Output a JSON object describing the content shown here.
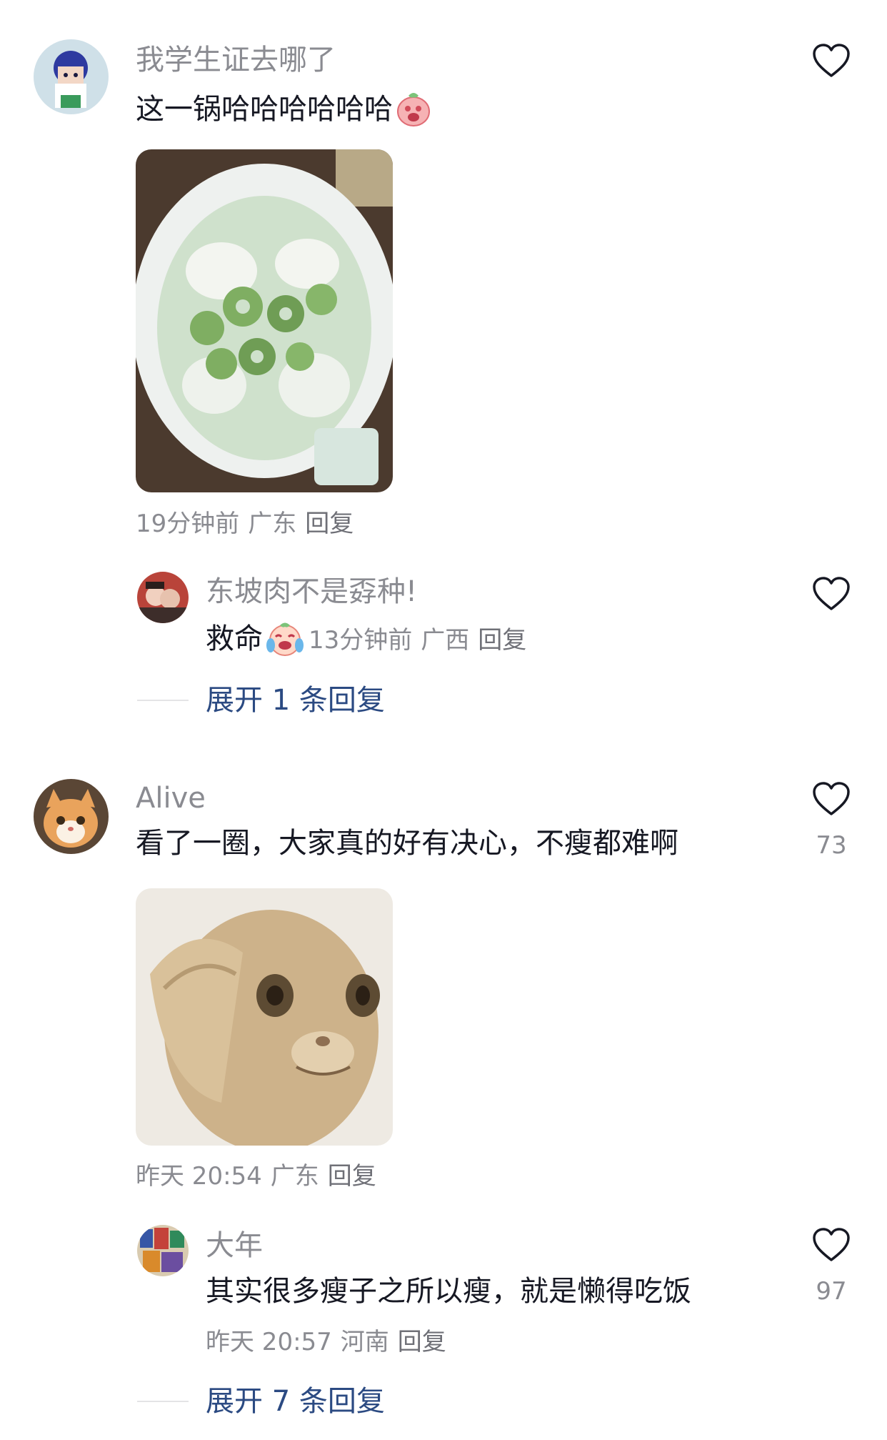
{
  "comments": [
    {
      "username": "我学生证去哪了",
      "text": "这一锅哈哈哈哈哈哈",
      "image": "bitter-melon-soup-pot",
      "time": "19分钟前",
      "location": "广东",
      "reply_label": "回复",
      "like_count": "",
      "reply": {
        "username": "东坡肉不是孬种!",
        "text": "救命",
        "time": "13分钟前",
        "location": "广西",
        "reply_label": "回复",
        "like_count": ""
      },
      "expand_label": "展开 1 条回复"
    },
    {
      "username": "Alive",
      "text": "看了一圈，大家真的好有决心，不瘦都难啊",
      "image": "scared-cat-meme",
      "time": "昨天 20:54",
      "location": "广东",
      "reply_label": "回复",
      "like_count": "73",
      "reply": {
        "username": "大年",
        "text": "其实很多瘦子之所以瘦，就是懒得吃饭",
        "time": "昨天 20:57",
        "location": "河南",
        "reply_label": "回复",
        "like_count": "97"
      },
      "expand_label": "展开 7 条回复"
    }
  ],
  "icons": {
    "like": "heart-outline-icon",
    "emoji_1": "laughing-emoji",
    "emoji_2": "crying-laughing-emoji"
  },
  "colors": {
    "username": "#8a8b91",
    "body_text": "#161823",
    "expand_link": "#2b4a82",
    "heart_stroke": "#161823"
  }
}
